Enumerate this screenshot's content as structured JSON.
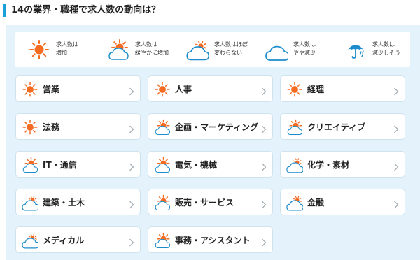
{
  "page": {
    "title": "14の業界・職種で求人数の動向は？"
  },
  "legend": [
    {
      "icon": "sun-icon",
      "line1": "求人数は",
      "line2": "増加"
    },
    {
      "icon": "sun-cloud-icon",
      "line1": "求人数は",
      "line2": "緩やかに増加"
    },
    {
      "icon": "cloud-sun-icon",
      "line1": "求人数はほぼ",
      "line2": "変わらない"
    },
    {
      "icon": "cloud-icon",
      "line1": "求人数は",
      "line2": "やや減少"
    },
    {
      "icon": "umbrella-icon",
      "line1": "求人数は",
      "line2": "減少しそう"
    }
  ],
  "categories": [
    {
      "label": "営業",
      "icon": "sun-icon"
    },
    {
      "label": "人事",
      "icon": "sun-icon"
    },
    {
      "label": "経理",
      "icon": "sun-icon"
    },
    {
      "label": "法務",
      "icon": "sun-icon"
    },
    {
      "label": "企画・マーケティング",
      "icon": "sun-cloud-icon"
    },
    {
      "label": "クリエイティブ",
      "icon": "sun-cloud-icon"
    },
    {
      "label": "IT・通信",
      "icon": "sun-cloud-icon"
    },
    {
      "label": "電気・機械",
      "icon": "sun-cloud-icon"
    },
    {
      "label": "化学・素材",
      "icon": "cloud-sun-icon"
    },
    {
      "label": "建築・土木",
      "icon": "cloud-sun-icon"
    },
    {
      "label": "販売・サービス",
      "icon": "sun-cloud-icon"
    },
    {
      "label": "金融",
      "icon": "cloud-sun-icon"
    },
    {
      "label": "メディカル",
      "icon": "cloud-sun-icon"
    },
    {
      "label": "事務・アシスタント",
      "icon": "sun-cloud-icon"
    }
  ],
  "colors": {
    "accent": "#1aa0d8",
    "sun": "#f46b21",
    "cloud_stroke": "#1d8ccc",
    "panel_bg": "#e3f2fb",
    "card_border": "#cfe3ef",
    "chevron": "#9aa5ad"
  }
}
